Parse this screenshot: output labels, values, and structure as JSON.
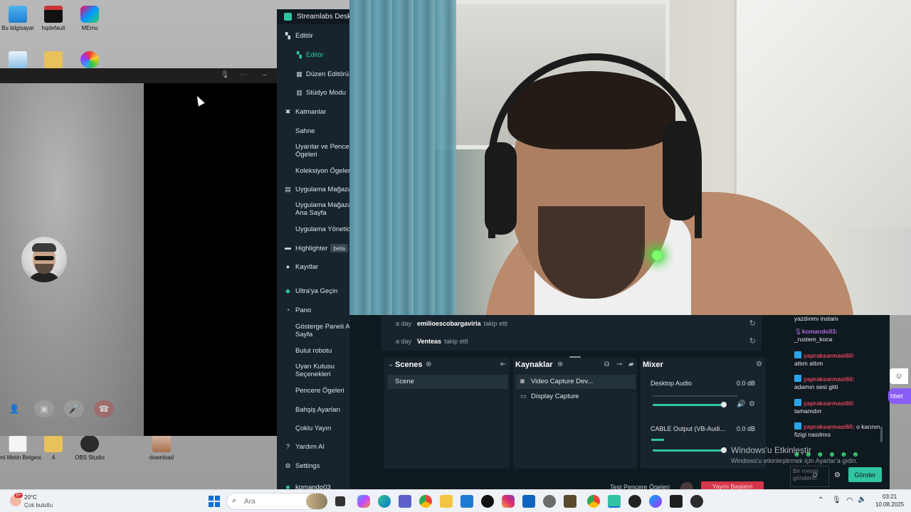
{
  "desktop": {
    "icons": [
      {
        "label": "Bu bilgisayar"
      },
      {
        "label": "hqdefault"
      },
      {
        "label": "MEmu"
      },
      {
        "label": "Yeni Metin Belgesi"
      },
      {
        "label": "4"
      },
      {
        "label": "OBS Studio"
      },
      {
        "label": "download"
      }
    ]
  },
  "streamlabs": {
    "title": "Streamlabs Deskt",
    "nav": {
      "editor_section": "Editör",
      "editor": "Editör",
      "layout_editor": "Düzen Editörü",
      "studio_mode": "Stüdyo Modu",
      "layers_section": "Katmanlar",
      "scene": "Sahne",
      "alerts_line1": "Uyarılar ve Pencer",
      "alerts_line2": "Ögeleri",
      "collection": "Koleksiyon Ögeleri",
      "app_store_section": "Uygulama Mağaza",
      "app_store_home_line1": "Uygulama Mağaza",
      "app_store_home_line2": "Ana Sayfa",
      "app_manager": "Uygulama Yönetici",
      "highlighter": "Highlighter",
      "beta": "beta",
      "recordings": "Kayıtlar",
      "ultra": "Ultra'ya Geçin",
      "dashboard_section": "Pano",
      "dashboard_home_line1": "Gösterge Paneli Ana",
      "dashboard_home_line2": "Sayfa",
      "cloudbot": "Bulut robotu",
      "alertbox_line1": "Uyarı Kutusu",
      "alertbox_line2": "Seçenekleri",
      "widgets": "Pencere Ögeleri",
      "tip_settings": "Bahşiş Ayarları",
      "multistream": "Çoklu Yayın",
      "help": "Yardım Al",
      "settings": "Settings",
      "user": "komando03"
    },
    "events": [
      {
        "time": "a day",
        "who": "emilioescobargaviria",
        "what": "takip etti"
      },
      {
        "time": "a day",
        "who": "Venteas",
        "what": "takip etti"
      }
    ],
    "scenes": {
      "title": "Scenes",
      "items": [
        "Scene"
      ]
    },
    "sources": {
      "title": "Kaynaklar",
      "items": [
        "Video Capture Dev...",
        "Display Capture"
      ]
    },
    "mixer": {
      "title": "Mixer",
      "channels": [
        {
          "name": "Desktop Audio",
          "db": "0.0 dB",
          "level": 0.9
        },
        {
          "name": "CABLE Output (VB-Audi...",
          "db": "0.0 dB",
          "level": 0.9
        }
      ]
    },
    "bottom_bar": {
      "test_widgets": "Test Pencere Ögeleri",
      "go_live": "Yayını Başlatın"
    }
  },
  "chat": {
    "messages": [
      {
        "user": "",
        "text": "yazdınmı instanı"
      },
      {
        "user": "komando03:",
        "text": "_rustem_koca"
      },
      {
        "user": "yapraksarmasi60:",
        "text": "attım attım"
      },
      {
        "user": "yapraksarmasi60:",
        "text": "adamın sesi gitti"
      },
      {
        "user": "yapraksarmasi60:",
        "text": "tamamdırr"
      },
      {
        "user": "yapraksarmasi60:",
        "text": "o karının fizigi nasılmıs"
      }
    ],
    "input_placeholder": "Bir mesaj gönderin",
    "send_label": "Gönder",
    "side_tab": "hbet"
  },
  "watermark": {
    "line1": "Windows'u Etkinleştir",
    "line2": "Windows'u etkinleştirmek için Ayarlar'a gidin."
  },
  "taskbar": {
    "weather_temp": "20°C",
    "weather_desc": "Çok bulutlu",
    "weather_badge": "9+",
    "search_placeholder": "Ara",
    "time": "03:21",
    "date": "10.08.2025"
  },
  "colors": {
    "accent": "#31c3a2",
    "panel": "#17242d",
    "bg": "#0f1a20",
    "chat_user_red": "#e0455a",
    "chat_user_purple": "#b06ad8"
  }
}
